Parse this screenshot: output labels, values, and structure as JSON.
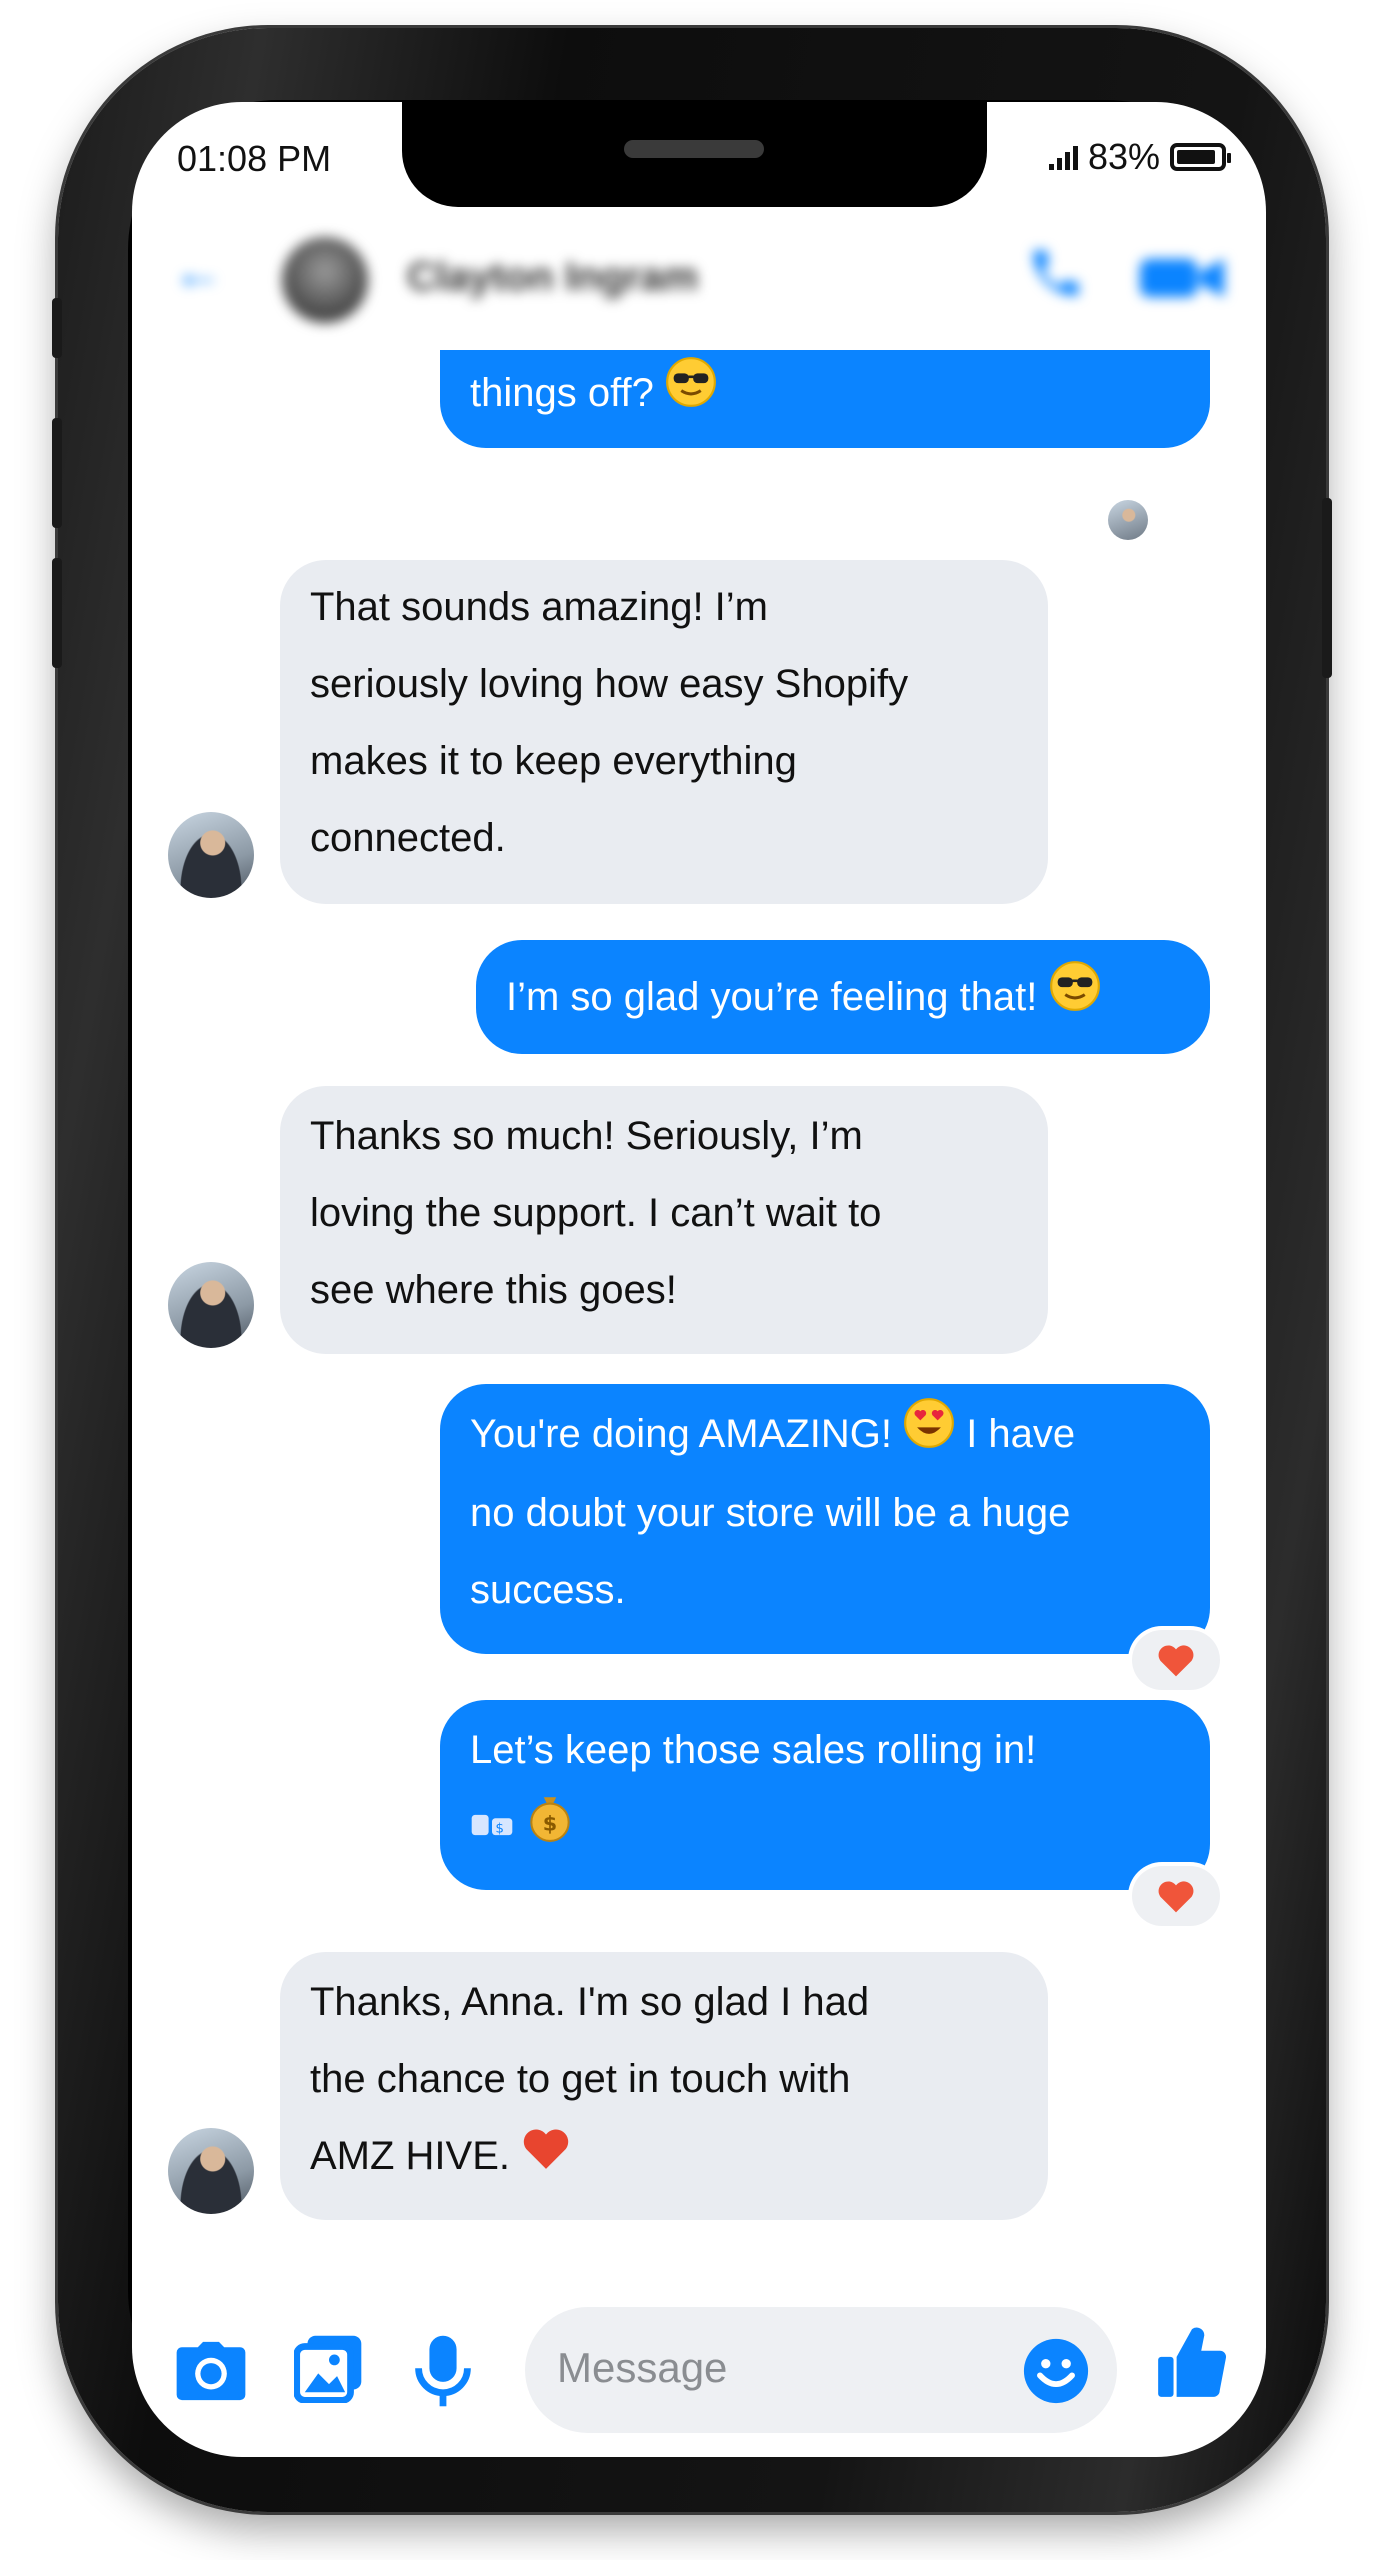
{
  "status_bar": {
    "time": "01:08 PM",
    "battery": "83%"
  },
  "header": {
    "contact_name": "Clayton Ingram"
  },
  "messages": [
    {
      "from": "out",
      "text": "things off?",
      "emoji": "sunglasses-emoji"
    },
    {
      "from": "in",
      "lines": [
        "That sounds amazing! I’m",
        "seriously loving how easy Shopify",
        "makes it to keep everything",
        "connected."
      ]
    },
    {
      "from": "out",
      "text": "I’m so glad you’re feeling that!",
      "emoji": "sunglasses-emoji"
    },
    {
      "from": "in",
      "lines": [
        "Thanks so much! Seriously, I’m",
        "loving the support. I can’t wait to",
        "see where this goes!"
      ]
    },
    {
      "from": "out",
      "line1a": "You're doing AMAZING!",
      "line1b": "I have",
      "line2": "no doubt your store will be a huge",
      "line3": "success.",
      "emoji": "heart-eyes-emoji",
      "reaction": "heart-reaction"
    },
    {
      "from": "out",
      "line1": "Let’s keep those sales rolling in!",
      "emoji": [
        "sale-tag-emoji",
        "money-bag-emoji"
      ],
      "reaction": "heart-reaction"
    },
    {
      "from": "in",
      "lines": [
        "Thanks, Anna. I'm so glad I had",
        "the chance to get in touch with",
        "AMZ HIVE."
      ],
      "emoji": "red-heart-emoji"
    }
  ],
  "composer": {
    "placeholder": "Message"
  },
  "colors": {
    "accent": "#0b84ff",
    "incoming_bubble": "#e9ecf1",
    "reaction_heart": "#f0553a"
  }
}
